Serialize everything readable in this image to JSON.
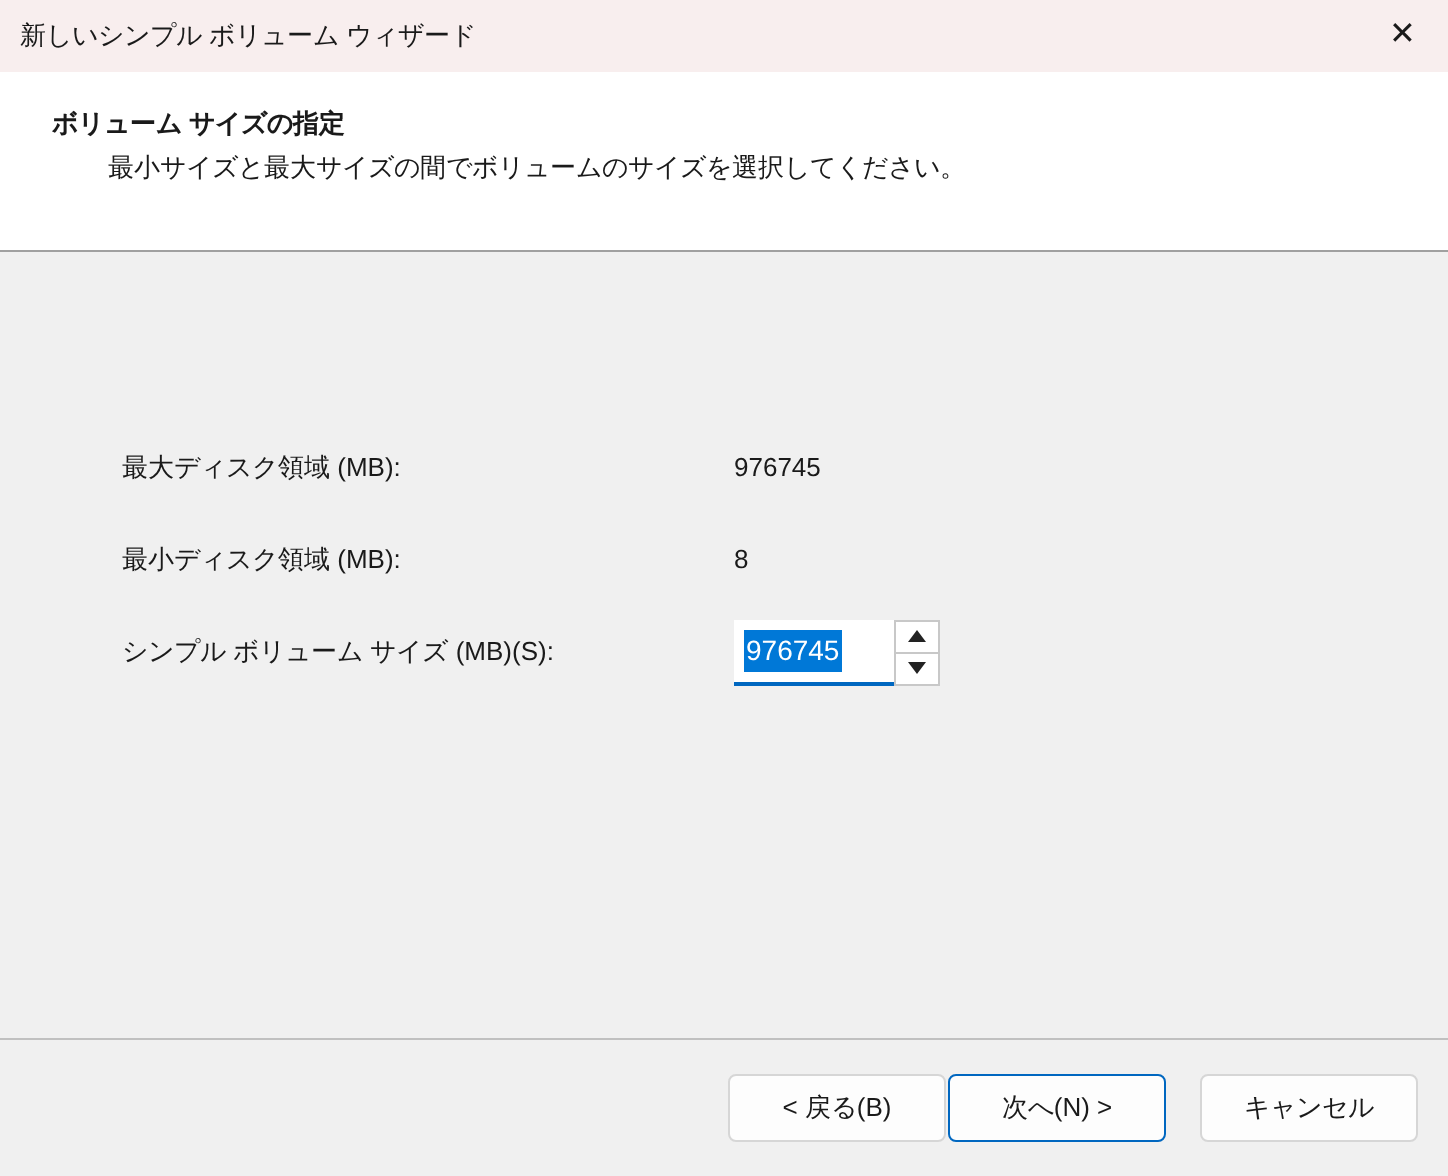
{
  "window": {
    "title": "新しいシンプル ボリューム ウィザード",
    "close": "✕"
  },
  "header": {
    "title": "ボリューム サイズの指定",
    "subtitle": "最小サイズと最大サイズの間でボリュームのサイズを選択してください。"
  },
  "fields": [
    {
      "kind": "readout",
      "label": "最大ディスク領域 (MB):",
      "value": "976745"
    },
    {
      "kind": "readout",
      "label": "最小ディスク領域 (MB):",
      "value": "8"
    },
    {
      "kind": "spinner",
      "label": "シンプル ボリューム サイズ (MB)(S):",
      "value": "976745",
      "selected": true
    }
  ],
  "buttons": [
    {
      "label": "< 戻る(B)",
      "default": false
    },
    {
      "label": "次へ(N) >",
      "default": true
    },
    {
      "label": "キャンセル",
      "default": false
    }
  ]
}
